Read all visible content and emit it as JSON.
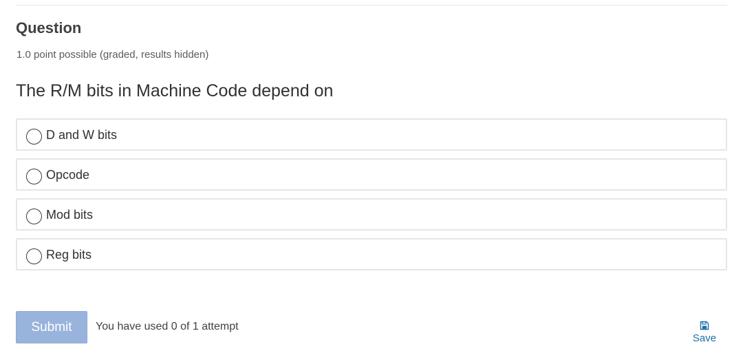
{
  "problem": {
    "title": "Question",
    "points": "1.0 point possible (graded, results hidden)",
    "prompt": "The R/M bits in Machine Code depend on",
    "choices": [
      {
        "label": "D and W bits",
        "selected": false
      },
      {
        "label": "Opcode",
        "selected": false
      },
      {
        "label": "Mod bits",
        "selected": false
      },
      {
        "label": "Reg bits",
        "selected": false
      }
    ]
  },
  "actions": {
    "submit_label": "Submit",
    "submit_enabled": false,
    "attempts_text": "You have used 0 of 1 attempt",
    "save_label": "Save",
    "save_icon": "save-icon"
  },
  "colors": {
    "submit_bg": "#98b3dc",
    "link": "#1a6fa8"
  }
}
